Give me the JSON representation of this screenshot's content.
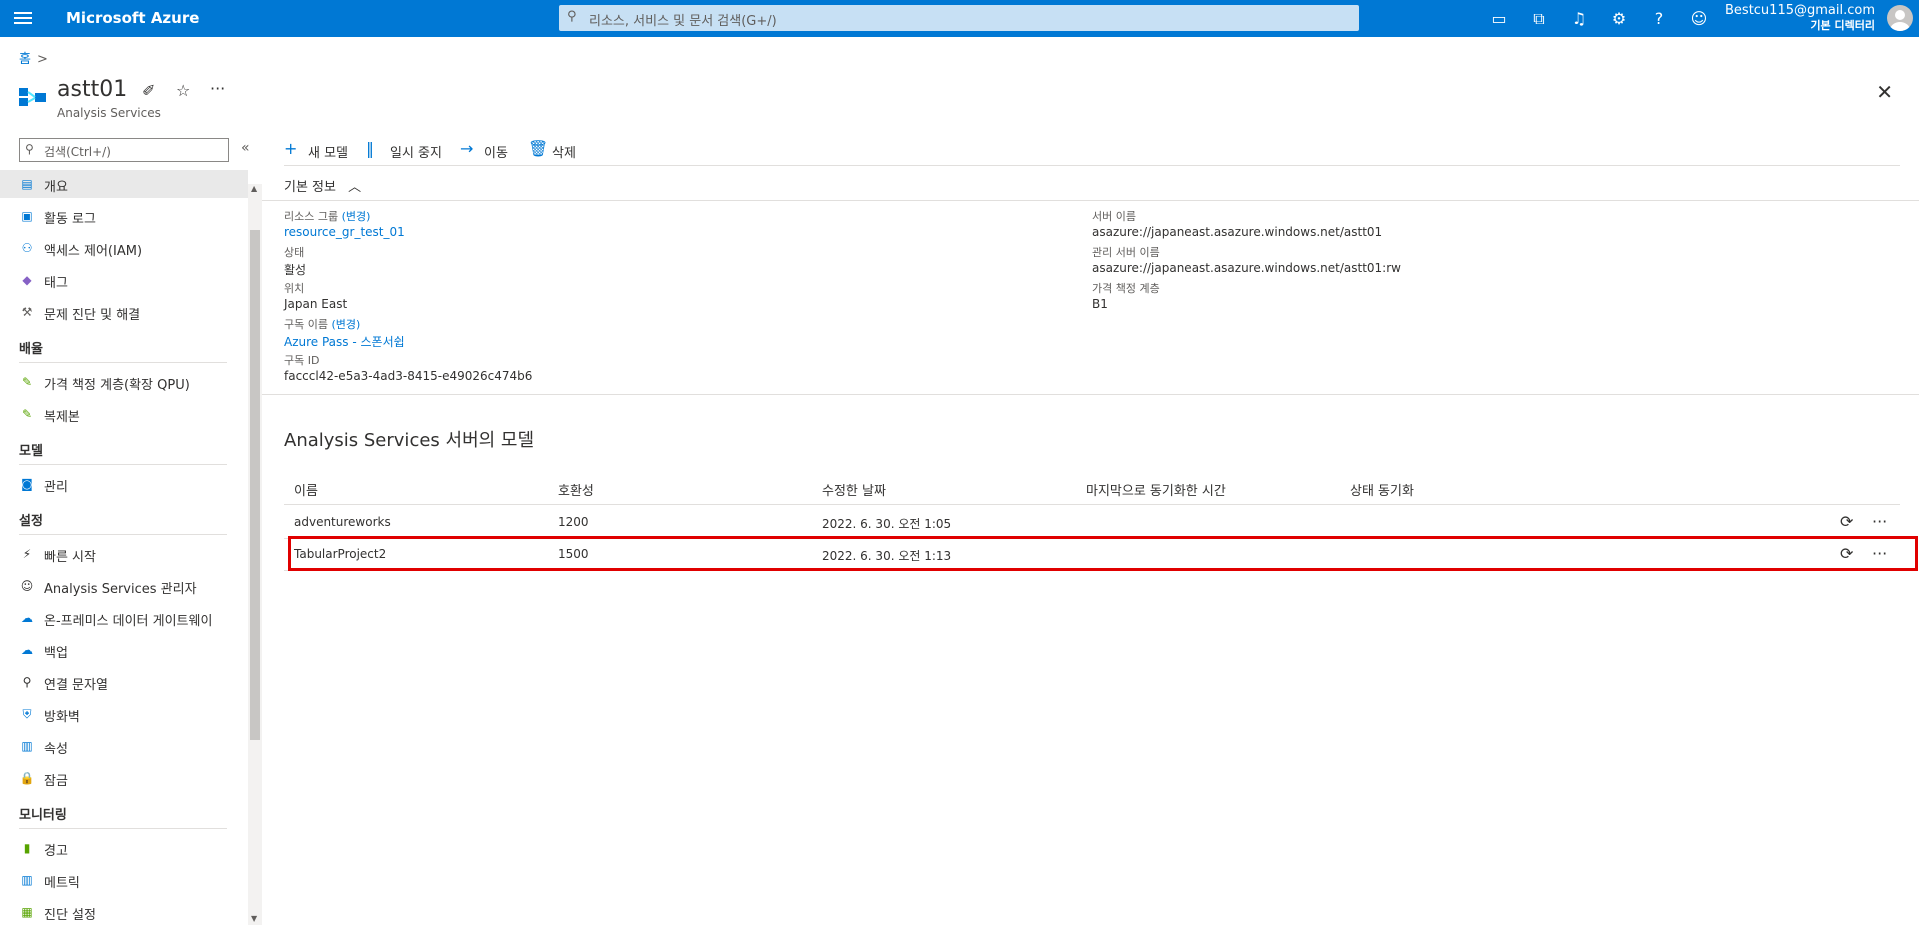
{
  "topbar": {
    "brand": "Microsoft Azure",
    "search_placeholder": "리소스, 서비스 및 문서 검색(G+/)",
    "account_email": "Bestcu115@gmail.com",
    "account_directory": "기본 디렉터리",
    "icons": [
      "cloud-shell-icon",
      "directory-filter-icon",
      "notifications-icon",
      "settings-icon",
      "help-icon",
      "feedback-icon"
    ]
  },
  "breadcrumb": {
    "home": "홈",
    "sep": ">"
  },
  "resource": {
    "name": "astt01",
    "type": "Analysis Services"
  },
  "sidebar": {
    "search_placeholder": "검색(Ctrl+/)",
    "collapse_glyph": "«",
    "items": [
      {
        "label": "개요",
        "icon": "overview-icon",
        "glyph": "▤",
        "color": "#0078d4",
        "active": true
      },
      {
        "label": "활동 로그",
        "icon": "activity-log-icon",
        "glyph": "▣",
        "color": "#0078d4"
      },
      {
        "label": "액세스 제어(IAM)",
        "icon": "iam-icon",
        "glyph": "⚇",
        "color": "#0078d4"
      },
      {
        "label": "태그",
        "icon": "tag-icon",
        "glyph": "◆",
        "color": "#8661c5"
      },
      {
        "label": "문제 진단 및 해결",
        "icon": "wrench-icon",
        "glyph": "⚒",
        "color": "#605e5c"
      }
    ],
    "groups": [
      {
        "title": "배율",
        "items": [
          {
            "label": "가격 책정 계층(확장 QPU)",
            "icon": "pricing-tier-icon",
            "glyph": "✎",
            "color": "#57a300"
          },
          {
            "label": "복제본",
            "icon": "replica-icon",
            "glyph": "✎",
            "color": "#57a300"
          }
        ]
      },
      {
        "title": "모델",
        "items": [
          {
            "label": "관리",
            "icon": "manage-icon",
            "glyph": "◙",
            "color": "#0078d4"
          }
        ]
      },
      {
        "title": "설정",
        "items": [
          {
            "label": "빠른 시작",
            "icon": "lightning-icon",
            "glyph": "⚡",
            "color": "#323130"
          },
          {
            "label": "Analysis Services 관리자",
            "icon": "person-icon",
            "glyph": "☺",
            "color": "#323130"
          },
          {
            "label": "온-프레미스 데이터 게이트웨이",
            "icon": "gateway-icon",
            "glyph": "☁",
            "color": "#0078d4"
          },
          {
            "label": "백업",
            "icon": "backup-icon",
            "glyph": "☁",
            "color": "#0078d4"
          },
          {
            "label": "연결 문자열",
            "icon": "plug-icon",
            "glyph": "⚲",
            "color": "#323130"
          },
          {
            "label": "방화벽",
            "icon": "firewall-icon",
            "glyph": "⛨",
            "color": "#0078d4"
          },
          {
            "label": "속성",
            "icon": "properties-icon",
            "glyph": "▥",
            "color": "#0078d4"
          },
          {
            "label": "잠금",
            "icon": "lock-icon",
            "glyph": "🔒",
            "color": "#0078d4"
          }
        ]
      },
      {
        "title": "모니터링",
        "items": [
          {
            "label": "경고",
            "icon": "alert-icon",
            "glyph": "▮",
            "color": "#57a300"
          },
          {
            "label": "메트릭",
            "icon": "metrics-icon",
            "glyph": "▥",
            "color": "#0078d4"
          },
          {
            "label": "진단 설정",
            "icon": "diagnostic-icon",
            "glyph": "▦",
            "color": "#57a300"
          }
        ]
      }
    ]
  },
  "commands": [
    {
      "label": "새 모델",
      "icon": "plus-icon",
      "glyph": "+"
    },
    {
      "label": "일시 중지",
      "icon": "pause-icon",
      "glyph": "‖"
    },
    {
      "label": "이동",
      "icon": "arrow-right-icon",
      "glyph": "→"
    },
    {
      "label": "삭제",
      "icon": "trash-icon",
      "glyph": "🗑"
    }
  ],
  "essentials": {
    "title": "기본 정보",
    "left": [
      {
        "label": "리소스 그룹",
        "change": "(변경)",
        "value": "resource_gr_test_01",
        "link": true
      },
      {
        "label": "상태",
        "value": "활성"
      },
      {
        "label": "위치",
        "value": "Japan East"
      },
      {
        "label": "구독 이름",
        "change": "(변경)",
        "value": "Azure Pass - 스폰서쉽",
        "link": true
      },
      {
        "label": "구독 ID",
        "value": "facccl42-e5a3-4ad3-8415-e49026c474b6"
      }
    ],
    "right": [
      {
        "label": "서버 이름",
        "value": "asazure://japaneast.asazure.windows.net/astt01"
      },
      {
        "label": "관리 서버 이름",
        "value": "asazure://japaneast.asazure.windows.net/astt01:rw"
      },
      {
        "label": "가격 책정 계층",
        "value": "B1"
      }
    ]
  },
  "models": {
    "title": "Analysis Services 서버의 모델",
    "columns": [
      "이름",
      "호환성",
      "수정한 날짜",
      "마지막으로 동기화한 시간",
      "상태 동기화"
    ],
    "rows": [
      {
        "name": "adventureworks",
        "compat": "1200",
        "modified": "2022. 6. 30. 오전 1:05",
        "last_sync": "",
        "sync_status": ""
      },
      {
        "name": "TabularProject2",
        "compat": "1500",
        "modified": "2022. 6. 30. 오전 1:13",
        "last_sync": "",
        "sync_status": ""
      }
    ],
    "sync_glyph": "⟳",
    "more_glyph": "···"
  },
  "colors": {
    "brand_blue": "#0078d4",
    "highlight_red": "#e00000"
  }
}
